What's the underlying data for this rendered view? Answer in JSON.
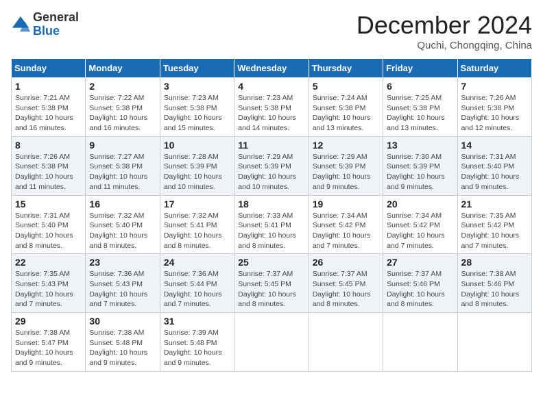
{
  "logo": {
    "general": "General",
    "blue": "Blue"
  },
  "title": "December 2024",
  "subtitle": "Quchi, Chongqing, China",
  "weekdays": [
    "Sunday",
    "Monday",
    "Tuesday",
    "Wednesday",
    "Thursday",
    "Friday",
    "Saturday"
  ],
  "weeks": [
    [
      {
        "day": "1",
        "sunrise": "7:21 AM",
        "sunset": "5:38 PM",
        "daylight": "10 hours and 16 minutes."
      },
      {
        "day": "2",
        "sunrise": "7:22 AM",
        "sunset": "5:38 PM",
        "daylight": "10 hours and 16 minutes."
      },
      {
        "day": "3",
        "sunrise": "7:23 AM",
        "sunset": "5:38 PM",
        "daylight": "10 hours and 15 minutes."
      },
      {
        "day": "4",
        "sunrise": "7:23 AM",
        "sunset": "5:38 PM",
        "daylight": "10 hours and 14 minutes."
      },
      {
        "day": "5",
        "sunrise": "7:24 AM",
        "sunset": "5:38 PM",
        "daylight": "10 hours and 13 minutes."
      },
      {
        "day": "6",
        "sunrise": "7:25 AM",
        "sunset": "5:38 PM",
        "daylight": "10 hours and 13 minutes."
      },
      {
        "day": "7",
        "sunrise": "7:26 AM",
        "sunset": "5:38 PM",
        "daylight": "10 hours and 12 minutes."
      }
    ],
    [
      {
        "day": "8",
        "sunrise": "7:26 AM",
        "sunset": "5:38 PM",
        "daylight": "10 hours and 11 minutes."
      },
      {
        "day": "9",
        "sunrise": "7:27 AM",
        "sunset": "5:38 PM",
        "daylight": "10 hours and 11 minutes."
      },
      {
        "day": "10",
        "sunrise": "7:28 AM",
        "sunset": "5:39 PM",
        "daylight": "10 hours and 10 minutes."
      },
      {
        "day": "11",
        "sunrise": "7:29 AM",
        "sunset": "5:39 PM",
        "daylight": "10 hours and 10 minutes."
      },
      {
        "day": "12",
        "sunrise": "7:29 AM",
        "sunset": "5:39 PM",
        "daylight": "10 hours and 9 minutes."
      },
      {
        "day": "13",
        "sunrise": "7:30 AM",
        "sunset": "5:39 PM",
        "daylight": "10 hours and 9 minutes."
      },
      {
        "day": "14",
        "sunrise": "7:31 AM",
        "sunset": "5:40 PM",
        "daylight": "10 hours and 9 minutes."
      }
    ],
    [
      {
        "day": "15",
        "sunrise": "7:31 AM",
        "sunset": "5:40 PM",
        "daylight": "10 hours and 8 minutes."
      },
      {
        "day": "16",
        "sunrise": "7:32 AM",
        "sunset": "5:40 PM",
        "daylight": "10 hours and 8 minutes."
      },
      {
        "day": "17",
        "sunrise": "7:32 AM",
        "sunset": "5:41 PM",
        "daylight": "10 hours and 8 minutes."
      },
      {
        "day": "18",
        "sunrise": "7:33 AM",
        "sunset": "5:41 PM",
        "daylight": "10 hours and 8 minutes."
      },
      {
        "day": "19",
        "sunrise": "7:34 AM",
        "sunset": "5:42 PM",
        "daylight": "10 hours and 7 minutes."
      },
      {
        "day": "20",
        "sunrise": "7:34 AM",
        "sunset": "5:42 PM",
        "daylight": "10 hours and 7 minutes."
      },
      {
        "day": "21",
        "sunrise": "7:35 AM",
        "sunset": "5:42 PM",
        "daylight": "10 hours and 7 minutes."
      }
    ],
    [
      {
        "day": "22",
        "sunrise": "7:35 AM",
        "sunset": "5:43 PM",
        "daylight": "10 hours and 7 minutes."
      },
      {
        "day": "23",
        "sunrise": "7:36 AM",
        "sunset": "5:43 PM",
        "daylight": "10 hours and 7 minutes."
      },
      {
        "day": "24",
        "sunrise": "7:36 AM",
        "sunset": "5:44 PM",
        "daylight": "10 hours and 7 minutes."
      },
      {
        "day": "25",
        "sunrise": "7:37 AM",
        "sunset": "5:45 PM",
        "daylight": "10 hours and 8 minutes."
      },
      {
        "day": "26",
        "sunrise": "7:37 AM",
        "sunset": "5:45 PM",
        "daylight": "10 hours and 8 minutes."
      },
      {
        "day": "27",
        "sunrise": "7:37 AM",
        "sunset": "5:46 PM",
        "daylight": "10 hours and 8 minutes."
      },
      {
        "day": "28",
        "sunrise": "7:38 AM",
        "sunset": "5:46 PM",
        "daylight": "10 hours and 8 minutes."
      }
    ],
    [
      {
        "day": "29",
        "sunrise": "7:38 AM",
        "sunset": "5:47 PM",
        "daylight": "10 hours and 9 minutes."
      },
      {
        "day": "30",
        "sunrise": "7:38 AM",
        "sunset": "5:48 PM",
        "daylight": "10 hours and 9 minutes."
      },
      {
        "day": "31",
        "sunrise": "7:39 AM",
        "sunset": "5:48 PM",
        "daylight": "10 hours and 9 minutes."
      },
      null,
      null,
      null,
      null
    ]
  ],
  "labels": {
    "sunrise": "Sunrise:",
    "sunset": "Sunset:",
    "daylight": "Daylight:"
  }
}
